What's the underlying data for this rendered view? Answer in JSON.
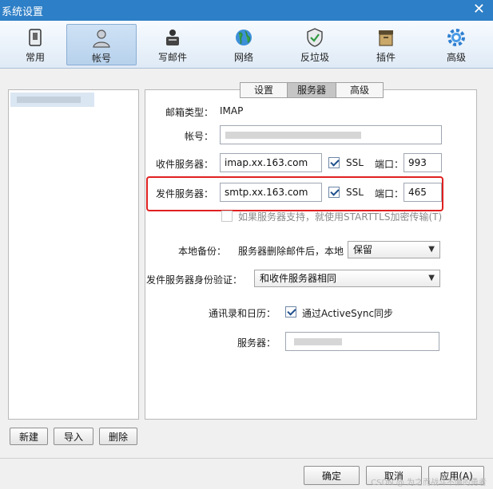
{
  "window": {
    "title": "系统设置",
    "close_glyph": "✕"
  },
  "toolbar": {
    "items": [
      {
        "label": "常用",
        "icon": "general-icon"
      },
      {
        "label": "帐号",
        "icon": "account-icon"
      },
      {
        "label": "写邮件",
        "icon": "compose-icon"
      },
      {
        "label": "网络",
        "icon": "network-icon"
      },
      {
        "label": "反垃圾",
        "icon": "antispam-icon"
      },
      {
        "label": "插件",
        "icon": "plugin-icon"
      },
      {
        "label": "高级",
        "icon": "advanced-icon"
      }
    ],
    "active": "帐号"
  },
  "left": {
    "buttons": {
      "new": "新建",
      "import": "导入",
      "delete": "删除"
    }
  },
  "tabs": [
    "设置",
    "服务器",
    "高级"
  ],
  "active_tab": "服务器",
  "form": {
    "mailbox_type_label": "邮箱类型：",
    "mailbox_type_value": "IMAP",
    "account_label": "帐号：",
    "incoming_label": "收件服务器：",
    "incoming_value": "imap.xx.163.com",
    "incoming_ssl": "SSL",
    "incoming_port_label": "端口：",
    "incoming_port": "993",
    "outgoing_label": "发件服务器：",
    "outgoing_value": "smtp.xx.163.com",
    "outgoing_ssl": "SSL",
    "outgoing_port_label": "端口：",
    "outgoing_port": "465",
    "starttls_text": "如果服务器支持，就使用STARTTLS加密传输(T)",
    "backup_label": "本地备份：",
    "backup_desc": "服务器删除邮件后，本地",
    "backup_value": "保留",
    "auth_label": "发件服务器身份验证：",
    "auth_value": "和收件服务器相同",
    "contacts_label": "通讯录和日历：",
    "activesync_text": "通过ActiveSync同步",
    "server_label": "服务器："
  },
  "bottom": {
    "ok": "确定",
    "cancel": "取消",
    "apply": "应用(A)"
  },
  "watermark": "CSDN @ 为之而战斗不懈的勇者"
}
